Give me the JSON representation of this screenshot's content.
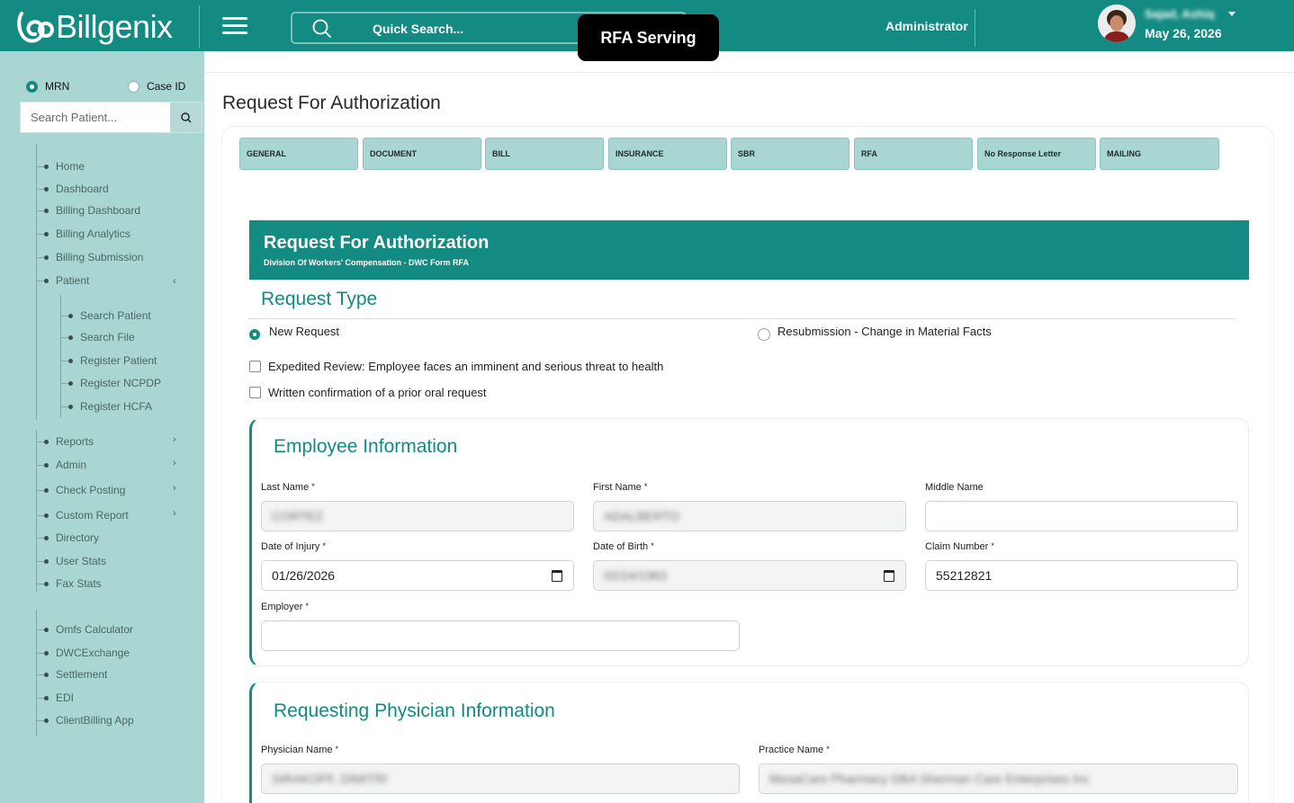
{
  "header": {
    "brand": "Billgenix",
    "search_placeholder": "Quick Search...",
    "overlay_badge": "RFA Serving",
    "role": "Administrator",
    "user_name": "Sajad, Ashiq",
    "date": "May 26, 2026"
  },
  "sidebar": {
    "mrn_label": "MRN",
    "caseid_label": "Case ID",
    "search_placeholder": "Search Patient...",
    "items": [
      {
        "label": "Home"
      },
      {
        "label": "Dashboard"
      },
      {
        "label": "Billing Dashboard"
      },
      {
        "label": "Billing Analytics"
      },
      {
        "label": "Billing Submission"
      },
      {
        "label": "Patient",
        "expanded": true
      },
      {
        "label": "Search Patient"
      },
      {
        "label": "Search File"
      },
      {
        "label": "Register Patient"
      },
      {
        "label": "Register NCPDP"
      },
      {
        "label": "Register HCFA"
      },
      {
        "label": "Reports"
      },
      {
        "label": "Admin"
      },
      {
        "label": "Check Posting"
      },
      {
        "label": "Custom Report"
      },
      {
        "label": "Directory"
      },
      {
        "label": "User Stats"
      },
      {
        "label": "Fax Stats"
      },
      {
        "label": "Omfs Calculator"
      },
      {
        "label": "DWCExchange"
      },
      {
        "label": "Settlement"
      },
      {
        "label": "EDI"
      },
      {
        "label": "ClientBilling App"
      }
    ]
  },
  "page": {
    "title": "Request For Authorization",
    "tabs": [
      "GENERAL",
      "DOCUMENT",
      "BILL",
      "INSURANCE",
      "SBR",
      "RFA",
      "No Response Letter",
      "MAILING"
    ],
    "banner_title": "Request For Authorization",
    "banner_subtitle": "Division Of Workers' Compensation - DWC Form RFA",
    "request_type": {
      "title": "Request Type",
      "option_new": "New Request",
      "option_resub": "Resubmission - Change in Material Facts",
      "expedited": "Expedited Review: Employee faces an imminent and serious threat to health",
      "written": "Written confirmation of a prior oral request"
    },
    "employee": {
      "title": "Employee Information",
      "last_name_label": "Last Name",
      "last_name": "CORTEZ",
      "first_name_label": "First Name",
      "first_name": "ADALBERTO",
      "middle_name_label": "Middle Name",
      "middle_name": "",
      "doi_label": "Date of Injury",
      "doi": "01/26/2026",
      "dob_label": "Date of Birth",
      "dob": "02/24/1963",
      "claim_label": "Claim Number",
      "claim": "55212821",
      "employer_label": "Employer",
      "employer": ""
    },
    "physician": {
      "title": "Requesting Physician Information",
      "physician_label": "Physician Name",
      "physician": "SIRAKOFF, DIMITRI",
      "practice_label": "Practice Name",
      "practice": "MesaCare Pharmacy DBA Sherman Care Enterprises Inc"
    },
    "required_mark": "*"
  }
}
